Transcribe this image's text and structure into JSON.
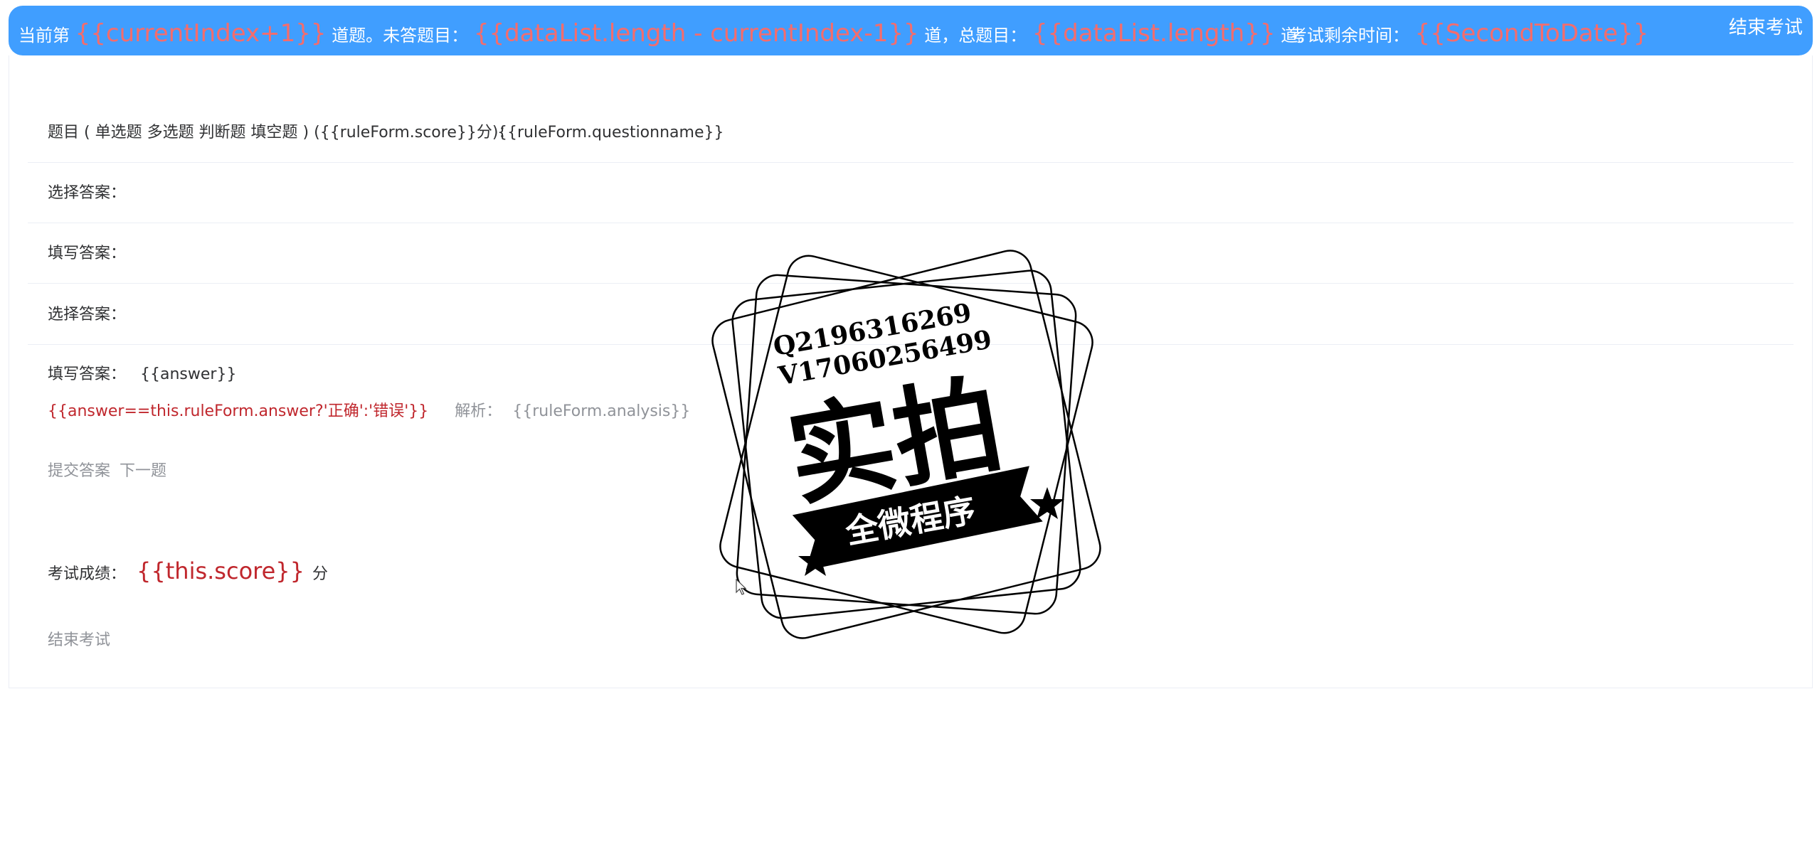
{
  "topbar": {
    "current_prefix": "当前第",
    "current_expr": "{{currentIndex+1}}",
    "current_suffix": "道题。未答题目：",
    "unanswered_expr": "{{dataList.length - currentIndex-1}}",
    "unanswered_suffix": "道，总题目：",
    "total_expr": "{{dataList.length}}",
    "total_suffix": "道。",
    "time_label": "考试剩余时间：",
    "time_expr": "{{SecondToDate}}",
    "end_exam_label": "结束考试"
  },
  "question": {
    "label": "题目 ( 单选题 多选题 判断题 填空题 ) ({{ruleForm.score}}分)：",
    "value": "{{ruleForm.questionname}}"
  },
  "answer_rows": [
    {
      "label": "选择答案：",
      "value": ""
    },
    {
      "label": "填写答案：",
      "value": ""
    },
    {
      "label": "选择答案：",
      "value": ""
    },
    {
      "label": "填写答案：",
      "value": "{{answer}}"
    }
  ],
  "result": {
    "expr": "{{answer==this.ruleForm.answer?'正确':'错误'}}",
    "analysis_label": "解析：",
    "analysis_value": "{{ruleForm.analysis}}"
  },
  "actions": {
    "submit_label": "提交答案",
    "next_label": "下一题"
  },
  "score": {
    "label": "考试成绩：",
    "value": "{{this.score}}",
    "unit": "分"
  },
  "end_exam_bottom_label": "结束考试",
  "watermark": {
    "line1": "Q2196316269",
    "line2": "V17060256499",
    "main_text": "实拍",
    "ribbon_text": "全微程序"
  },
  "colors": {
    "topbar_bg": "#409eff",
    "highlight": "#f56c6c",
    "result_red": "#c0272d",
    "muted_text": "#909399"
  }
}
